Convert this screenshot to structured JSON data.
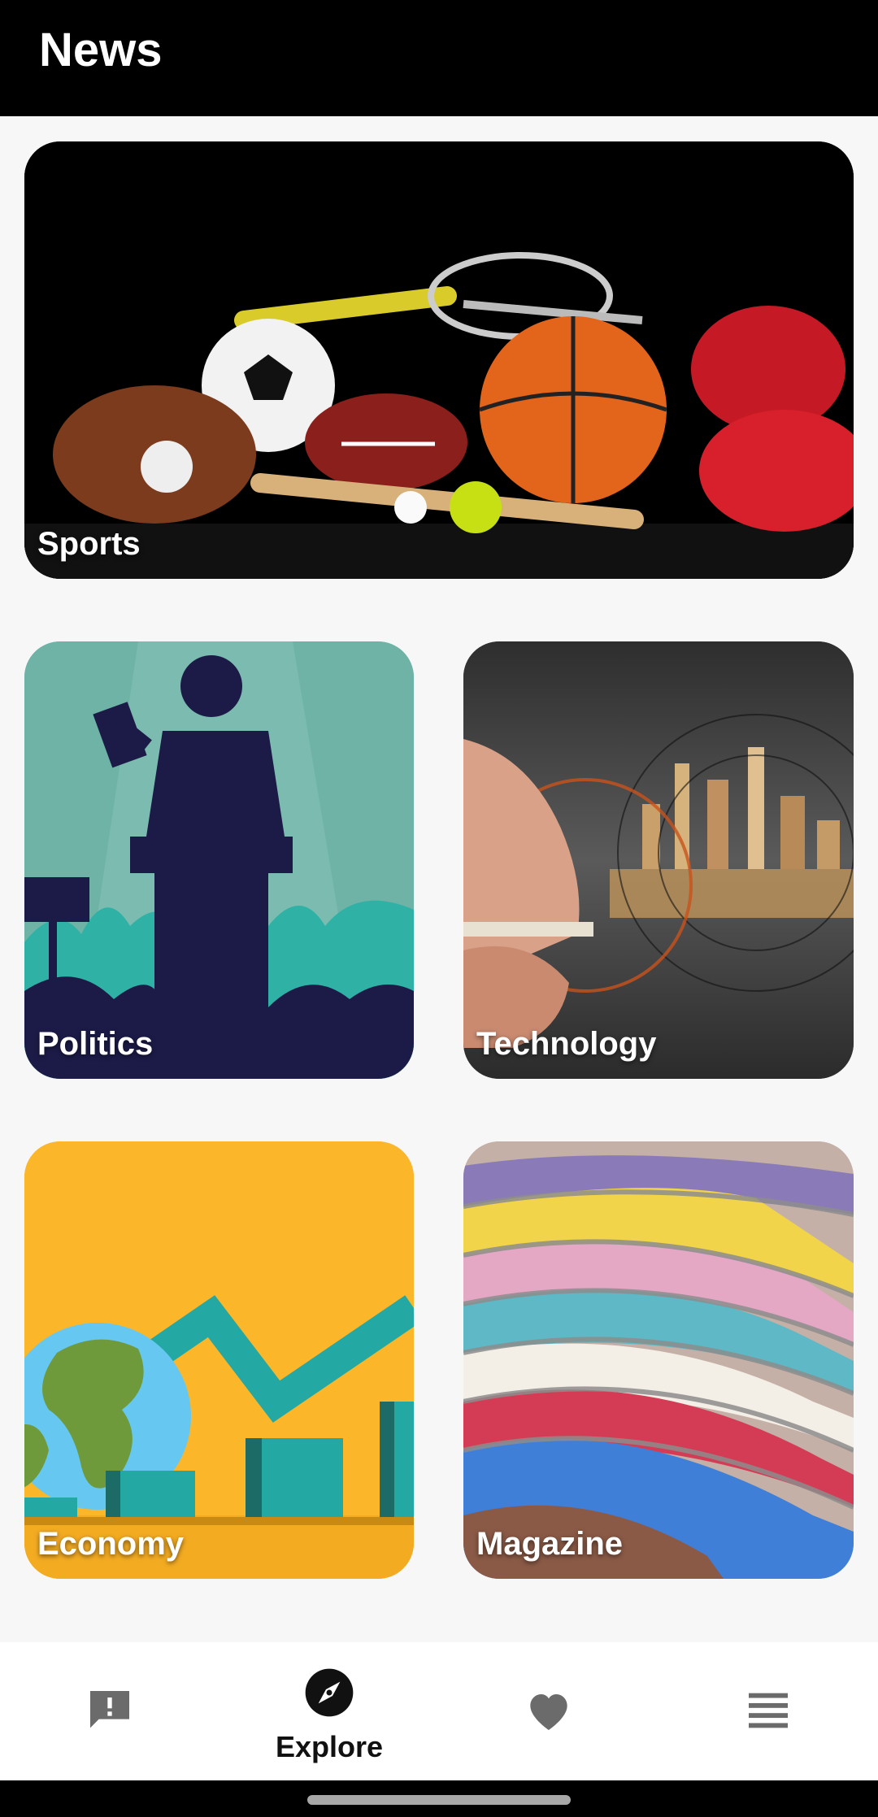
{
  "app": {
    "title": "News"
  },
  "categories": [
    {
      "id": "sports",
      "label": "Sports"
    },
    {
      "id": "politics",
      "label": "Politics"
    },
    {
      "id": "technology",
      "label": "Technology"
    },
    {
      "id": "economy",
      "label": "Economy"
    },
    {
      "id": "magazine",
      "label": "Magazine"
    }
  ],
  "bottom_nav": {
    "selected": "explore",
    "items": [
      {
        "id": "feedback",
        "icon": "feedback-icon",
        "label": ""
      },
      {
        "id": "explore",
        "icon": "compass-icon",
        "label": "Explore"
      },
      {
        "id": "favorites",
        "icon": "heart-icon",
        "label": ""
      },
      {
        "id": "list",
        "icon": "list-icon",
        "label": ""
      }
    ]
  },
  "colors": {
    "app_bar": "#000000",
    "background": "#f7f7f7",
    "nav_icon_inactive": "#6b6b6b",
    "nav_icon_active": "#111111",
    "economy_bg": "#fbb62a",
    "politics_bg": "#6fb3a7"
  }
}
